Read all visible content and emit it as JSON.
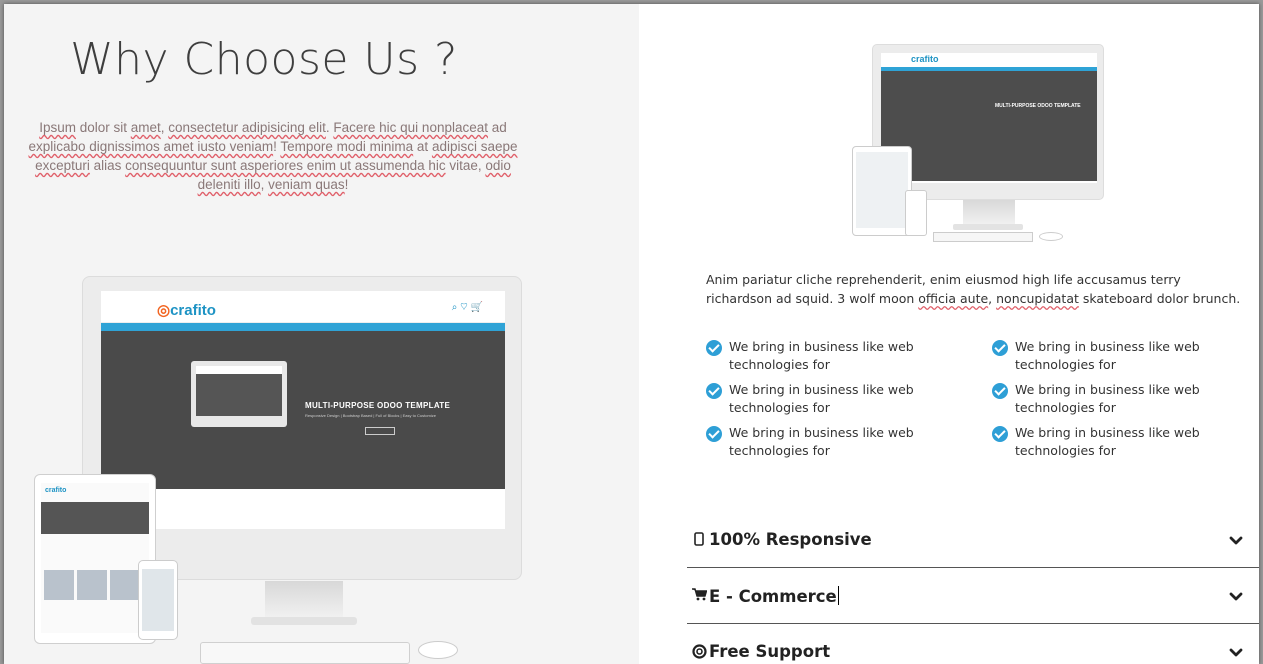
{
  "left": {
    "title": "Why Choose Us ?",
    "intro": [
      {
        "t": "Ipsum",
        "sq": true
      },
      {
        "t": " dolor sit ",
        "sq": false
      },
      {
        "t": "amet",
        "sq": true
      },
      {
        "t": ", ",
        "sq": false
      },
      {
        "t": "consectetur adipisicing elit",
        "sq": true
      },
      {
        "t": ". ",
        "sq": false
      },
      {
        "t": "Facere hic qui nonplaceat",
        "sq": true
      },
      {
        "t": " ad ",
        "sq": false
      },
      {
        "t": "explicabo dignissimos amet iusto veniam",
        "sq": true
      },
      {
        "t": "! ",
        "sq": false
      },
      {
        "t": "Tempore modi minima",
        "sq": true
      },
      {
        "t": " at ",
        "sq": false
      },
      {
        "t": "adipisci saepe excepturi",
        "sq": true
      },
      {
        "t": " alias ",
        "sq": false
      },
      {
        "t": "consequuntur sunt asperiores enim ut assumenda hic",
        "sq": true
      },
      {
        "t": " vitae, ",
        "sq": false
      },
      {
        "t": "odio deleniti illo",
        "sq": true
      },
      {
        "t": ", ",
        "sq": false
      },
      {
        "t": "veniam quas",
        "sq": true
      },
      {
        "t": "!",
        "sq": false
      }
    ],
    "mock": {
      "logo": "crafito",
      "hero_title": "MULTI-PURPOSE ODOO TEMPLATE",
      "hero_sub": "Responsive Design | Bootstrap Based | Full of Blocks | Easy to Customize",
      "hero_btn": "BUY NOW"
    }
  },
  "right": {
    "mock_logo": "crafito",
    "mock_title": "MULTI-PURPOSE ODOO TEMPLATE",
    "description": [
      {
        "t": "Anim pariatur cliche reprehenderit, enim eiusmod high life accusamus terry richardson ad squid. 3 wolf moon ",
        "sq": false
      },
      {
        "t": "officia aute",
        "sq": true
      },
      {
        "t": ", ",
        "sq": false
      },
      {
        "t": "noncupidatat",
        "sq": true
      },
      {
        "t": " skateboard dolor brunch.",
        "sq": false
      }
    ],
    "features": [
      "We bring in business like web technologies for",
      "We bring in business like web technologies for",
      "We bring in business like web technologies for",
      "We bring in business like web technologies for",
      "We bring in business like web technologies for",
      "We bring in business like web technologies for"
    ],
    "accordion": [
      {
        "icon": "mobile-icon",
        "label": "100% Responsive"
      },
      {
        "icon": "cart-icon",
        "label": "E - Commerce"
      },
      {
        "icon": "lifebuoy-icon",
        "label": "Free Support"
      }
    ]
  },
  "colors": {
    "accent": "#2e9fd6",
    "brand_orange": "#f26522",
    "left_bg": "#f4f4f4"
  }
}
